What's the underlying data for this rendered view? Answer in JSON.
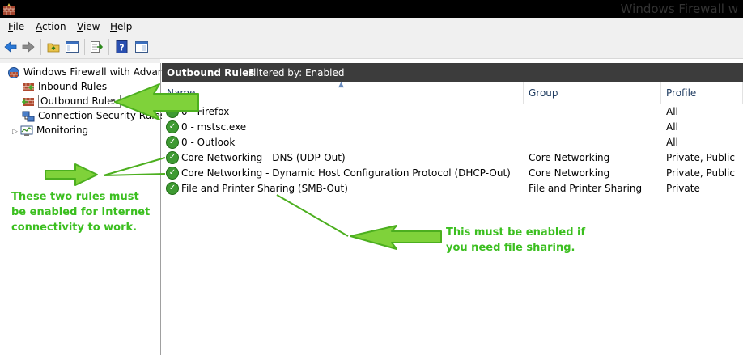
{
  "window": {
    "title": "Windows Firewall w"
  },
  "menu": [
    {
      "label": "File",
      "ul": "F",
      "rest": "ile"
    },
    {
      "label": "Action",
      "ul": "A",
      "rest": "ction"
    },
    {
      "label": "View",
      "ul": "V",
      "rest": "iew"
    },
    {
      "label": "Help",
      "ul": "H",
      "rest": "elp"
    }
  ],
  "tree": {
    "root": "Windows Firewall with Advance",
    "items": [
      "Inbound Rules",
      "Outbound Rules",
      "Connection Security Rules",
      "Monitoring"
    ]
  },
  "pane": {
    "title": "Outbound Rules",
    "filter": "Filtered by: Enabled"
  },
  "columns": {
    "name": "Name",
    "group": "Group",
    "profile": "Profile"
  },
  "rows": [
    {
      "name": "0 - Firefox",
      "group": "",
      "profile": "All"
    },
    {
      "name": "0 - mstsc.exe",
      "group": "",
      "profile": "All"
    },
    {
      "name": "0 - Outlook",
      "group": "",
      "profile": "All"
    },
    {
      "name": "Core Networking - DNS (UDP-Out)",
      "group": "Core Networking",
      "profile": "Private, Public"
    },
    {
      "name": "Core Networking - Dynamic Host Configuration Protocol (DHCP-Out)",
      "group": "Core Networking",
      "profile": "Private, Public"
    },
    {
      "name": "File and Printer Sharing (SMB-Out)",
      "group": "File and Printer Sharing",
      "profile": "Private"
    }
  ],
  "annotations": {
    "left": [
      "These two rules must",
      "be enabled for Internet",
      "connectivity to work."
    ],
    "right": [
      "This must be enabled if",
      "you need file sharing."
    ]
  },
  "colors": {
    "annotation": "#3bbf1f",
    "arrow_fill": "#7fd23a",
    "arrow_stroke": "#4caf1f"
  }
}
